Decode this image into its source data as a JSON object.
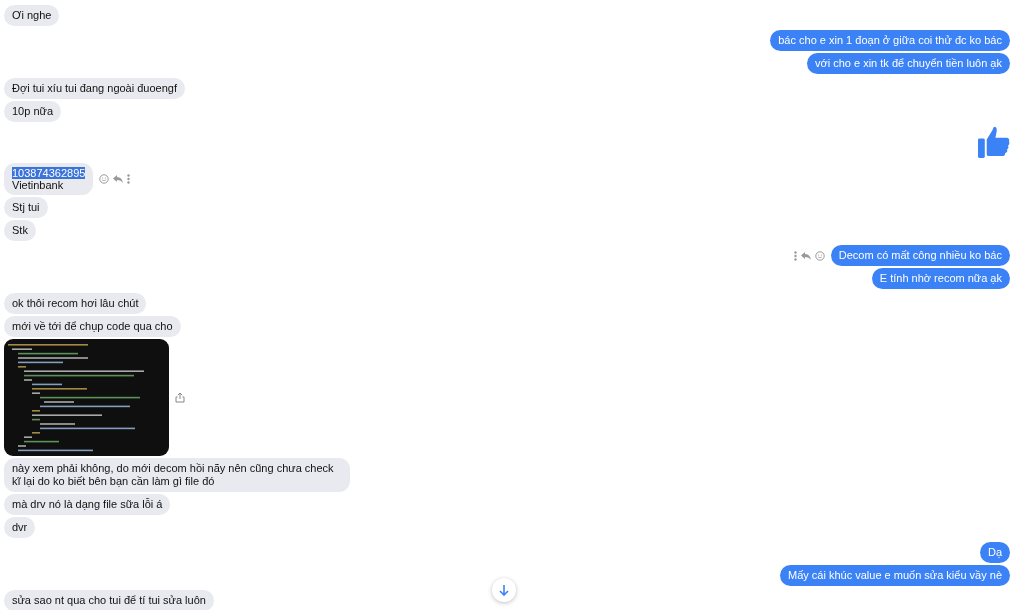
{
  "groups": [
    {
      "kind": "incoming",
      "messages": [
        {
          "kind": "text",
          "text": "Ơi nghe"
        }
      ]
    },
    {
      "kind": "outgoing",
      "messages": [
        {
          "kind": "text",
          "text": "bác cho e xin 1 đoạn ở giữa coi thử đc ko bác"
        },
        {
          "kind": "text",
          "text": "với cho e xin tk để chuyển tiền luôn ạk"
        }
      ]
    },
    {
      "kind": "incoming",
      "messages": [
        {
          "kind": "text",
          "text": "Đợi tui xíu tui đang ngoài đuoengf"
        },
        {
          "kind": "text",
          "text": "10p nữa"
        }
      ]
    },
    {
      "kind": "outgoing",
      "messages": [
        {
          "kind": "like"
        }
      ]
    },
    {
      "kind": "incoming",
      "messages": [
        {
          "kind": "text",
          "lines": [
            {
              "text": "103874362895",
              "selected": true
            },
            {
              "text": "Vietinbank",
              "selected": false
            }
          ],
          "actions": true
        },
        {
          "kind": "text",
          "text": "Stj tui"
        },
        {
          "kind": "text",
          "text": "Stk"
        }
      ]
    },
    {
      "kind": "outgoing",
      "messages": [
        {
          "kind": "text",
          "text": "Decom có mất công nhiều ko bác",
          "actions": true
        },
        {
          "kind": "text",
          "text": "E tính nhờ recom nữa ạk"
        }
      ]
    },
    {
      "kind": "incoming",
      "messages": [
        {
          "kind": "text",
          "text": "ok thôi recom hơi lâu chút"
        },
        {
          "kind": "text",
          "text": "mới về tới để chụp code qua cho"
        },
        {
          "kind": "picture",
          "share": true
        },
        {
          "kind": "text",
          "text": "này xem phải không, do mới decom hồi nãy nên cũng chưa check kĩ lại do ko biết bên bạn cần làm gì file đó"
        },
        {
          "kind": "text",
          "text": "mà drv nó là dạng file sữa lỗi á"
        },
        {
          "kind": "text",
          "text": "dvr"
        }
      ]
    },
    {
      "kind": "outgoing",
      "messages": [
        {
          "kind": "text",
          "text": "Dạ"
        },
        {
          "kind": "text",
          "text": "Mấy cái khúc value e muốn sửa kiểu vầy nè"
        }
      ]
    },
    {
      "kind": "incoming",
      "messages": [
        {
          "kind": "text",
          "text": "sửa sao nt qua cho tui để tí tui sửa luôn"
        }
      ]
    }
  ],
  "scroll_down_button": true
}
